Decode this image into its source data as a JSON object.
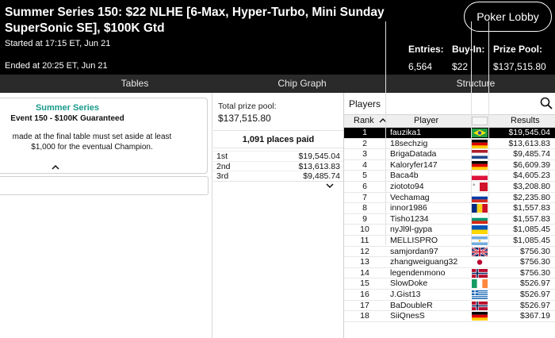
{
  "header": {
    "title": "Summer Series 150: $22 NLHE [6-Max, Hyper-Turbo, Mini Sunday SuperSonic SE], $100K Gtd",
    "started": "Started at 17:15 ET, Jun 21",
    "ended": "Ended at 20:25 ET, Jun 21",
    "lobby_button": "Poker Lobby",
    "stats": {
      "entries_label": "Entries:",
      "entries_value": "6,564",
      "buyin_label": "Buy-In:",
      "buyin_value": "$22",
      "pool_label": "Prize Pool:",
      "pool_value": "$137,515.80"
    }
  },
  "tabs": [
    "Tables",
    "Chip Graph",
    "Structure"
  ],
  "description": {
    "title": "Summer Series",
    "subtitle": "Event 150 - $100K Guaranteed",
    "text": "made at the final table must set aside at least $1,000 for the eventual Champion."
  },
  "prizes": {
    "pool_label": "Total prize pool:",
    "pool_value": "$137,515.80",
    "places_paid": "1,091 places paid",
    "rows": [
      {
        "pos": "1st",
        "amount": "$19,545.04"
      },
      {
        "pos": "2nd",
        "amount": "$13,613.83"
      },
      {
        "pos": "3rd",
        "amount": "$9,485.74"
      }
    ]
  },
  "players": {
    "title": "Players",
    "columns": {
      "rank": "Rank",
      "player": "Player",
      "results": "Results"
    },
    "rows": [
      {
        "rank": "1",
        "name": "fauzika1",
        "result": "$19,545.04",
        "flag": "brazil",
        "selected": true
      },
      {
        "rank": "2",
        "name": "18sechzig",
        "result": "$13,613.83",
        "flag": "germany"
      },
      {
        "rank": "3",
        "name": "BrigaDatada",
        "result": "$9,485.74",
        "flag": "netherlands"
      },
      {
        "rank": "4",
        "name": "Kaloryfer147",
        "result": "$6,609.39",
        "flag": "germany"
      },
      {
        "rank": "5",
        "name": "Baca4b",
        "result": "$4,605.23",
        "flag": "poland"
      },
      {
        "rank": "6",
        "name": "ziototo94",
        "result": "$3,208.80",
        "flag": "malta"
      },
      {
        "rank": "7",
        "name": "Vechamag",
        "result": "$2,235.80",
        "flag": "russia"
      },
      {
        "rank": "8",
        "name": "innor1986",
        "result": "$1,557.83",
        "flag": "romania"
      },
      {
        "rank": "9",
        "name": "Tisho1234",
        "result": "$1,557.83",
        "flag": "bulgaria"
      },
      {
        "rank": "10",
        "name": "nyJl9l-gypa",
        "result": "$1,085.45",
        "flag": "ukraine"
      },
      {
        "rank": "11",
        "name": "MELLISPRO",
        "result": "$1,085.45",
        "flag": "argentina"
      },
      {
        "rank": "12",
        "name": "samjordan97",
        "result": "$756.30",
        "flag": "uk"
      },
      {
        "rank": "13",
        "name": "zhangweiguang32",
        "result": "$756.30",
        "flag": "japan"
      },
      {
        "rank": "14",
        "name": "legendenmono",
        "result": "$756.30",
        "flag": "norway"
      },
      {
        "rank": "15",
        "name": "SlowDoke",
        "result": "$526.97",
        "flag": "ireland"
      },
      {
        "rank": "16",
        "name": "J.Gist13",
        "result": "$526.97",
        "flag": "greece"
      },
      {
        "rank": "17",
        "name": "BaDoubleR",
        "result": "$526.97",
        "flag": "norway"
      },
      {
        "rank": "18",
        "name": "SiiQnesS",
        "result": "$367.19",
        "flag": "germany"
      }
    ]
  }
}
